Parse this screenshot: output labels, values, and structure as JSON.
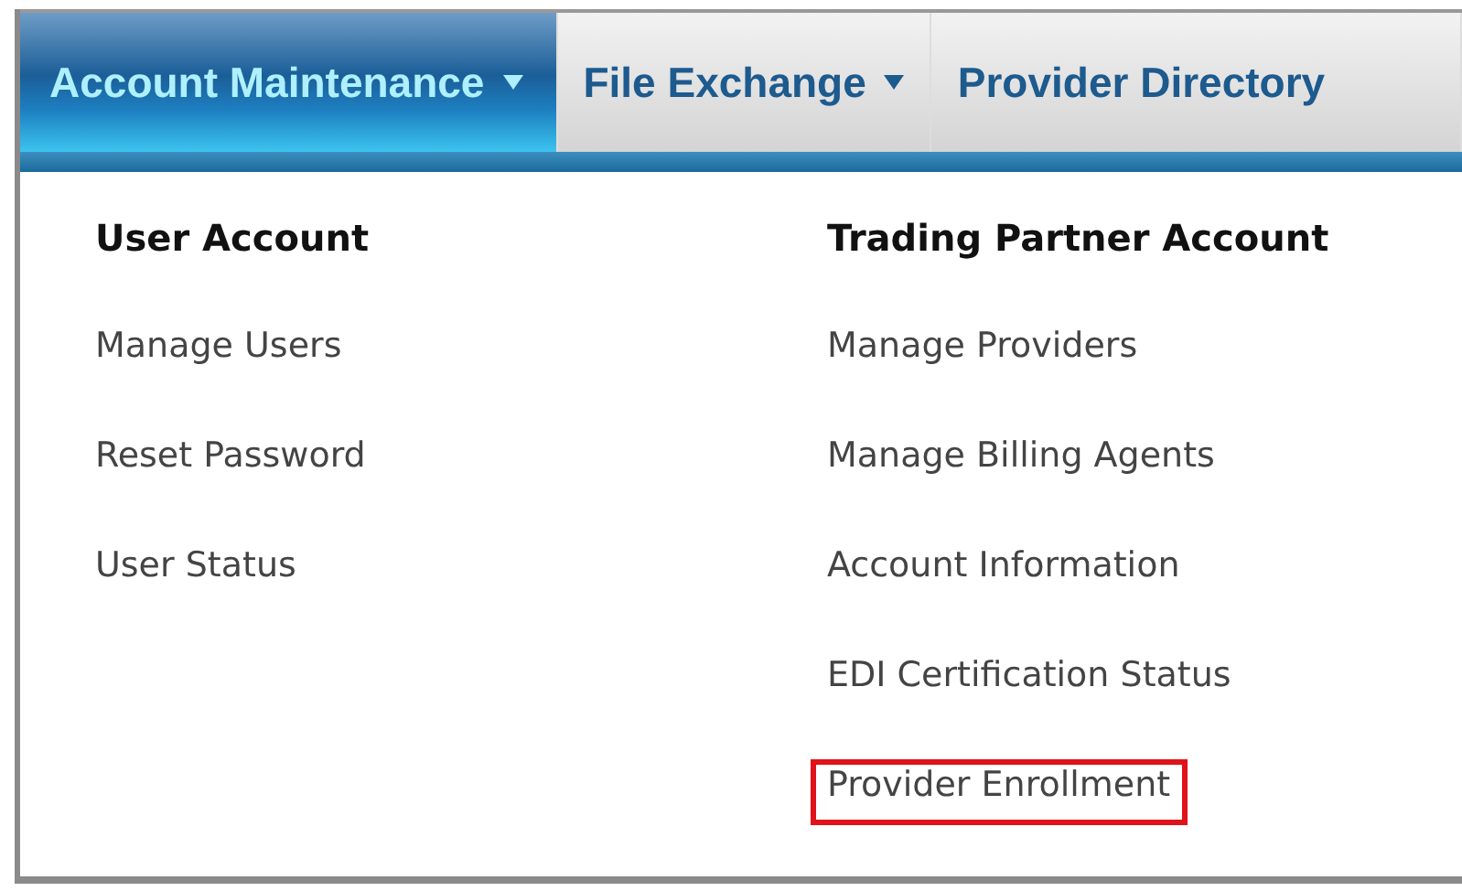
{
  "nav": {
    "tabs": [
      {
        "label": "Account Maintenance",
        "selected": true,
        "dropdown": true
      },
      {
        "label": "File Exchange",
        "selected": false,
        "dropdown": true
      },
      {
        "label": "Provider Directory",
        "selected": false,
        "dropdown": false
      }
    ]
  },
  "menu": {
    "columns": [
      {
        "heading": "User Account",
        "items": [
          {
            "label": "Manage Users",
            "highlighted": false
          },
          {
            "label": "Reset Password",
            "highlighted": false
          },
          {
            "label": "User Status",
            "highlighted": false
          }
        ]
      },
      {
        "heading": "Trading Partner Account",
        "items": [
          {
            "label": "Manage Providers",
            "highlighted": false
          },
          {
            "label": "Manage Billing Agents",
            "highlighted": false
          },
          {
            "label": "Account Information",
            "highlighted": false
          },
          {
            "label": "EDI Certification Status",
            "highlighted": false
          },
          {
            "label": "Provider Enrollment",
            "highlighted": true
          }
        ]
      }
    ]
  }
}
